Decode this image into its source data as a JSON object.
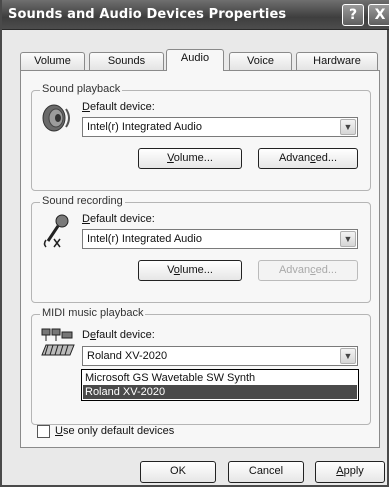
{
  "window": {
    "title": "Sounds and Audio Devices Properties",
    "help_glyph": "?",
    "close_glyph": "X"
  },
  "tabs": [
    {
      "label": "Volume"
    },
    {
      "label": "Sounds"
    },
    {
      "label": "Audio",
      "active": true
    },
    {
      "label": "Voice"
    },
    {
      "label": "Hardware"
    }
  ],
  "sound_playback": {
    "group_label": "Sound playback",
    "default_label_prefix": "D",
    "default_label_rest": "efault device:",
    "device": "Intel(r) Integrated Audio",
    "volume_button": {
      "pre": "",
      "u": "V",
      "post": "olume..."
    },
    "advanced_button": {
      "pre": "Advan",
      "u": "c",
      "post": "ed..."
    }
  },
  "sound_recording": {
    "group_label": "Sound recording",
    "default_label_prefix": "D",
    "default_label_rest": "efault device:",
    "device": "Intel(r) Integrated Audio",
    "volume_button": {
      "pre": "V",
      "u": "o",
      "post": "lume..."
    },
    "advanced_button": {
      "pre": "Advan",
      "u": "c",
      "post": "ed..."
    }
  },
  "midi_playback": {
    "group_label": "MIDI music playback",
    "default_label_prefix": "D",
    "default_label_u": "e",
    "default_label_rest": "fault device:",
    "device": "Roland XV-2020",
    "options": [
      "Microsoft GS Wavetable SW Synth",
      "Roland XV-2020"
    ],
    "selected_option": "Roland XV-2020"
  },
  "use_default": {
    "label_u": "U",
    "label_rest": "se only default devices",
    "checked": false
  },
  "footer": {
    "ok_label": "OK",
    "cancel_label": "Cancel",
    "apply_u": "A",
    "apply_rest": "pply"
  },
  "icons": {
    "playback": "speaker-icon",
    "recording": "microphone-icon",
    "midi": "midi-keyboard-icon"
  },
  "colors": {
    "titlebar": "#4d4d4d",
    "selection": "#4a4a4a"
  }
}
